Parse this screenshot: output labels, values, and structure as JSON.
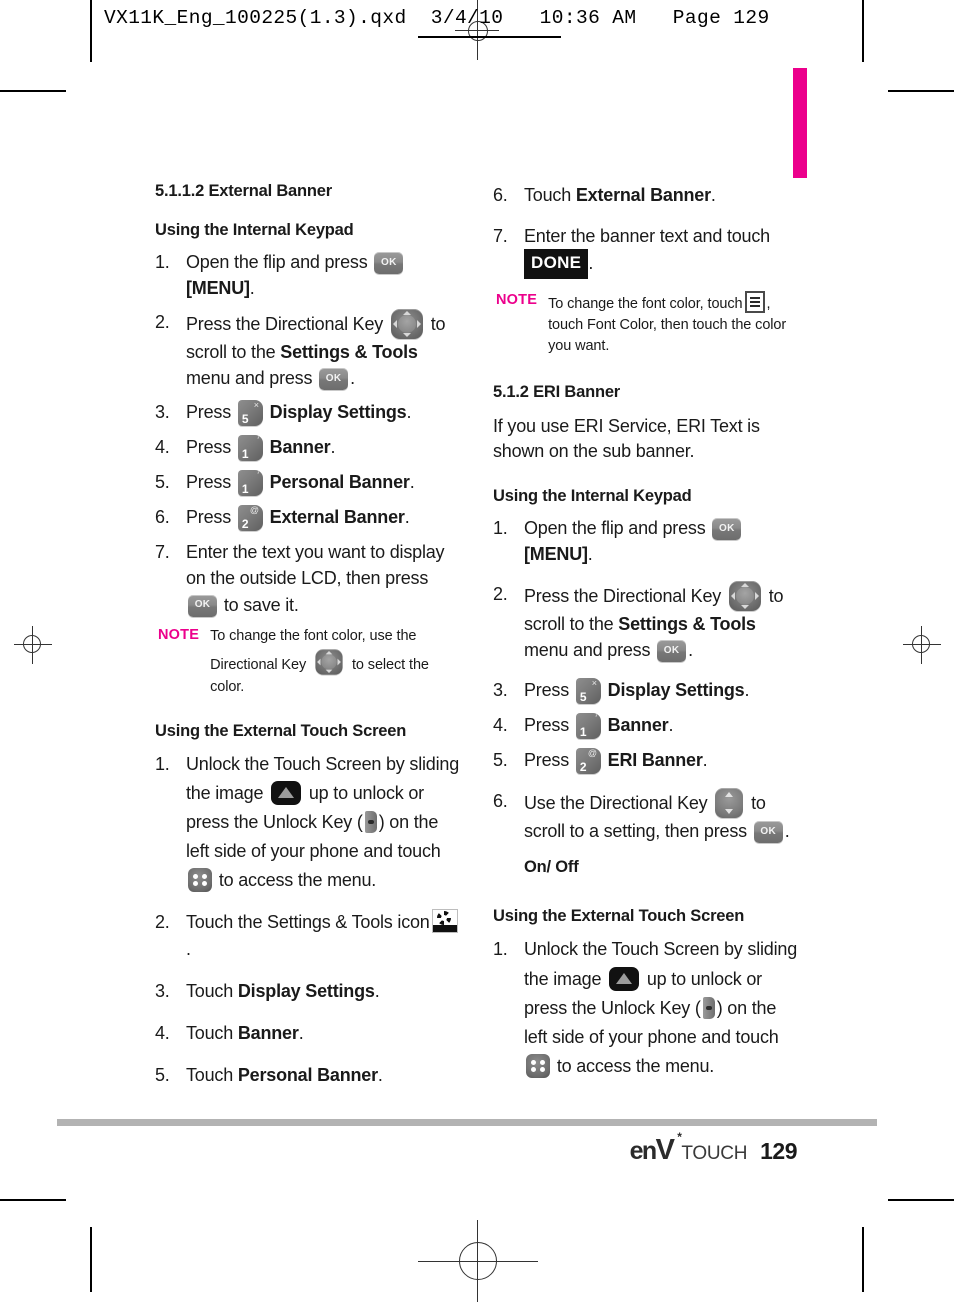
{
  "print_slug": {
    "text": "VX11K_Eng_100225(1.3).qxd  3/4/10   10:36 AM   Page 129"
  },
  "colors": {
    "accent_pink": "#EC008C",
    "footer_rule": "#B3B3B3"
  },
  "left_column": {
    "section_title": "5.1.1.2 External Banner",
    "group_1": {
      "heading": "Using the Internal Keypad",
      "steps": [
        {
          "num": "1.",
          "before": "Open the flip and press",
          "icon": "ok-key-icon",
          "after_bold": "[MENU]",
          "after": "."
        },
        {
          "num": "2.",
          "before": "Press the Directional Key",
          "icon": "directional-key-icon",
          "mid": "to scroll to the",
          "bold": "Settings & Tools",
          "mid2": "menu and press",
          "icon2": "ok-key-icon",
          "after": "."
        },
        {
          "num": "3.",
          "before": "Press",
          "key": "5",
          "key_symbol": "×",
          "bold": "Display Settings",
          "after": "."
        },
        {
          "num": "4.",
          "before": "Press",
          "key": "1",
          "key_symbol": "′",
          "bold": "Banner",
          "after": "."
        },
        {
          "num": "5.",
          "before": "Press",
          "key": "1",
          "key_symbol": "′",
          "bold": "Personal Banner",
          "after": "."
        },
        {
          "num": "6.",
          "before": "Press",
          "key": "2",
          "key_symbol": "@",
          "bold": "External Banner",
          "after": "."
        },
        {
          "num": "7.",
          "before": "Enter the text you want to display on the outside LCD, then press",
          "icon": "ok-key-icon",
          "after": "to save it."
        }
      ],
      "note": {
        "label": "NOTE",
        "part1": "To change the font color, use the Directional Key",
        "icon": "directional-key-icon",
        "part2": "to select the color."
      }
    },
    "group_2": {
      "heading": "Using the External Touch Screen",
      "steps": [
        {
          "num": "1.",
          "p1": "Unlock the Touch Screen by sliding the image",
          "icon1": "unlock-slide-icon",
          "p2": "up to unlock or press the Unlock Key (",
          "icon2": "unlock-key-icon",
          "p3": ") on the left side of your phone and touch",
          "icon3": "menu-dots-icon",
          "p4": "to access the menu."
        },
        {
          "num": "2.",
          "before": "Touch the Settings & Tools icon",
          "icon": "settings-tools-icon",
          "after": "."
        },
        {
          "num": "3.",
          "before": "Touch",
          "bold": "Display Settings",
          "after": "."
        },
        {
          "num": "4.",
          "before": "Touch",
          "bold": "Banner",
          "after": "."
        },
        {
          "num": "5.",
          "before": "Touch",
          "bold": "Personal Banner",
          "after": "."
        }
      ]
    }
  },
  "right_column": {
    "continued_steps": [
      {
        "num": "6.",
        "before": "Touch",
        "bold": "External Banner",
        "after": "."
      },
      {
        "num": "7.",
        "before": "Enter the banner text and touch",
        "button": "DONE",
        "after": "."
      }
    ],
    "note": {
      "label": "NOTE",
      "part1": "To change the font color, touch",
      "icon": "list-options-icon",
      "part2": ", touch Font Color, then touch the color you want."
    },
    "section_title": "5.1.2 ERI Banner",
    "intro": "If you use ERI Service, ERI Text is shown on the sub banner.",
    "group_1": {
      "heading": "Using the Internal Keypad",
      "steps": [
        {
          "num": "1.",
          "before": "Open the flip and press",
          "icon": "ok-key-icon",
          "after_bold": "[MENU]",
          "after": "."
        },
        {
          "num": "2.",
          "before": "Press the Directional Key",
          "icon": "directional-key-icon",
          "mid": "to scroll to the",
          "bold": "Settings & Tools",
          "mid2": "menu and press",
          "icon2": "ok-key-icon",
          "after": "."
        },
        {
          "num": "3.",
          "before": "Press",
          "key": "5",
          "key_symbol": "×",
          "bold": "Display Settings",
          "after": "."
        },
        {
          "num": "4.",
          "before": "Press",
          "key": "1",
          "key_symbol": "′",
          "bold": "Banner",
          "after": "."
        },
        {
          "num": "5.",
          "before": "Press",
          "key": "2",
          "key_symbol": "@",
          "bold": "ERI Banner",
          "after": "."
        },
        {
          "num": "6.",
          "before": "Use the Directional Key",
          "icon": "updown-key-icon",
          "mid": "to scroll to a setting, then press",
          "icon2": "ok-key-icon",
          "after": "."
        }
      ],
      "option_heading": "On/ Off"
    },
    "group_2": {
      "heading": "Using the External Touch Screen",
      "steps": [
        {
          "num": "1.",
          "p1": "Unlock the Touch Screen by sliding the image",
          "icon1": "unlock-slide-icon",
          "p2": "up to unlock or press the Unlock Key (",
          "icon2": "unlock-key-icon",
          "p3": ") on the left side of your phone and touch",
          "icon3": "menu-dots-icon",
          "p4": "to access the menu."
        }
      ]
    }
  },
  "footer": {
    "brand_en": "en",
    "brand_v": "V",
    "brand_touch": "TOUCH",
    "page_number": "129"
  }
}
